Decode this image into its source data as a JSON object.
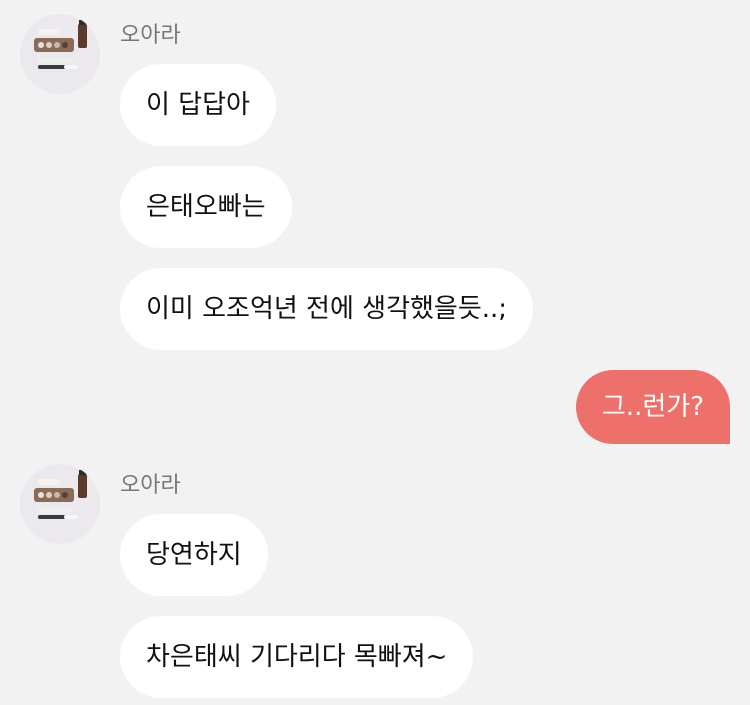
{
  "messages": [
    {
      "side": "incoming",
      "sender": "오아라",
      "text": "이 답답아"
    },
    {
      "side": "incoming",
      "text": "은태오빠는"
    },
    {
      "side": "incoming",
      "text": "이미 오조억년 전에 생각했을듯..;"
    },
    {
      "side": "outgoing",
      "text": "그..런가?"
    },
    {
      "side": "incoming",
      "sender": "오아라",
      "text": "당연하지"
    },
    {
      "side": "incoming",
      "text": "차은태씨 기다리다 목빠져~"
    }
  ],
  "colors": {
    "background": "#f2f2f2",
    "incoming_bubble": "#ffffff",
    "outgoing_bubble": "#ee706a",
    "sender_name": "#777777"
  },
  "icons": {
    "avatar": "profile-photo-products-icon"
  }
}
